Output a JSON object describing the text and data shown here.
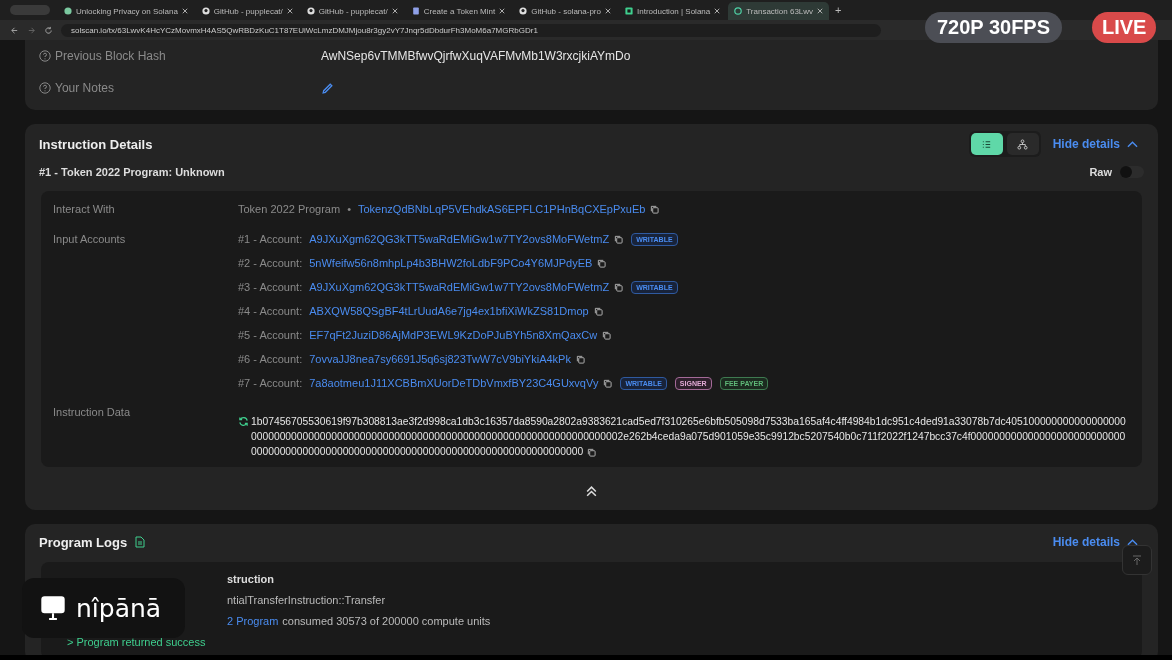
{
  "browser": {
    "tabs": [
      {
        "title": "Unlocking Privacy on Solana",
        "kind": "page",
        "selected": false
      },
      {
        "title": "GitHub - pupplecat/",
        "kind": "github",
        "selected": false
      },
      {
        "title": "GitHub - pupplecat/",
        "kind": "github",
        "selected": false
      },
      {
        "title": "Create a Token Mint",
        "kind": "doc",
        "selected": false
      },
      {
        "title": "GitHub - solana-pro",
        "kind": "github",
        "selected": false
      },
      {
        "title": "Introduction | Solana",
        "kind": "book",
        "selected": false
      },
      {
        "title": "Transaction 63Lwv",
        "kind": "solscan",
        "selected": true
      }
    ],
    "new_tab": "+",
    "url": "solscan.io/tx/63LwvK4HcYCzMovmxH4AS5QwRBDzKuC1T87EUiWcLmzDMJMjou8r3gy2vY7Jnqr5dDbdurFh3MoM6a7MGRbGDr1"
  },
  "summary": {
    "rows": [
      {
        "kind": "text",
        "label": "Previous Block Hash",
        "value": "AwNSep6vTMMBfwvQjrfwXuqVAFMvMb1W3rxcjkiAYmDo"
      },
      {
        "kind": "edit",
        "label": "Your Notes"
      }
    ]
  },
  "instruction_details": {
    "title": "Instruction Details",
    "view_buttons": [
      {
        "kind": "list",
        "selected": true
      },
      {
        "kind": "tree",
        "selected": false
      }
    ],
    "hide_link": "Hide details",
    "instruction_title": "#1 - Token 2022 Program: Unknown",
    "raw": {
      "label": "Raw",
      "on": false
    },
    "interact_with": {
      "label": "Interact With",
      "program": "Token 2022 Program",
      "separator": "•",
      "address": "TokenzQdBNbLqP5VEhdkAS6EPFLC1PHnBqCXEpPxuEb"
    },
    "input_accounts": {
      "label": "Input Accounts",
      "accounts": [
        {
          "index": "#1 - Account:",
          "address": "A9JXuXgm62QG3kTT5waRdEMiGw1w7TY2ovs8MoFWetmZ",
          "tags": [
            {
              "kind": "writable",
              "text": "WRITABLE"
            }
          ]
        },
        {
          "index": "#2 - Account:",
          "address": "5nWfeifw56n8mhpLp4b3BHW2foLdbF9PCo4Y6MJPdyEB"
        },
        {
          "index": "#3 - Account:",
          "address": "A9JXuXgm62QG3kTT5waRdEMiGw1w7TY2ovs8MoFWetmZ",
          "tags": [
            {
              "kind": "writable",
              "text": "WRITABLE"
            }
          ]
        },
        {
          "index": "#4 - Account:",
          "address": "ABXQW58QSgBF4tLrUudA6e7jg4ex1bfiXiWkZS81Dmop"
        },
        {
          "index": "#5 - Account:",
          "address": "EF7qFt2JuziD86AjMdP3EWL9KzDoPJuBYh5n8XmQaxCw"
        },
        {
          "index": "#6 - Account:",
          "address": "7ovvaJJ8nea7sy6691J5q6sj823TwW7cV9biYkiA4kPk"
        },
        {
          "index": "#7 - Account:",
          "address": "7a8aotmeu1J11XCBBmXUorDeTDbVmxfBY23C4GUxvqVy",
          "tags": [
            {
              "kind": "writable",
              "text": "WRITABLE"
            },
            {
              "kind": "signer",
              "text": "SIGNER"
            },
            {
              "kind": "fee_payer",
              "text": "FEE PAYER"
            }
          ]
        }
      ]
    },
    "instruction_data": {
      "label": "Instruction Data",
      "value": "1b07456705530619f97b308813ae3f2d998ca1db3c16357da8590a2802a9383621cad5ed7f310265e6bfb505098d7533ba165af4c4ff4984b1dc951c4ded91a33078b7dc40510000000000000000000000000000000000000000000000000000000000000000000000000000000002e262b4ceda9a075d901059e35c9912bc5207540b0c711f2022f1247bcc37c4f0000000000000000000000000000000000000000000000000000000000000000000000000000000000000"
    }
  },
  "program_logs": {
    "title": "Program Logs",
    "hide_link": "Hide details",
    "lines": [
      {
        "kind": "heading",
        "text": "struction"
      },
      {
        "kind": "partial",
        "text": "ntialTransferInstruction::Transfer"
      },
      {
        "kind": "consumed",
        "link": "2 Program",
        "text": "consumed 30573 of 200000 compute units"
      },
      {
        "kind": "success",
        "text": "> Program returned success"
      }
    ]
  },
  "stream_overlay": {
    "quality": "720P 30FPS",
    "live": "LIVE",
    "channel": "nîpānā"
  }
}
